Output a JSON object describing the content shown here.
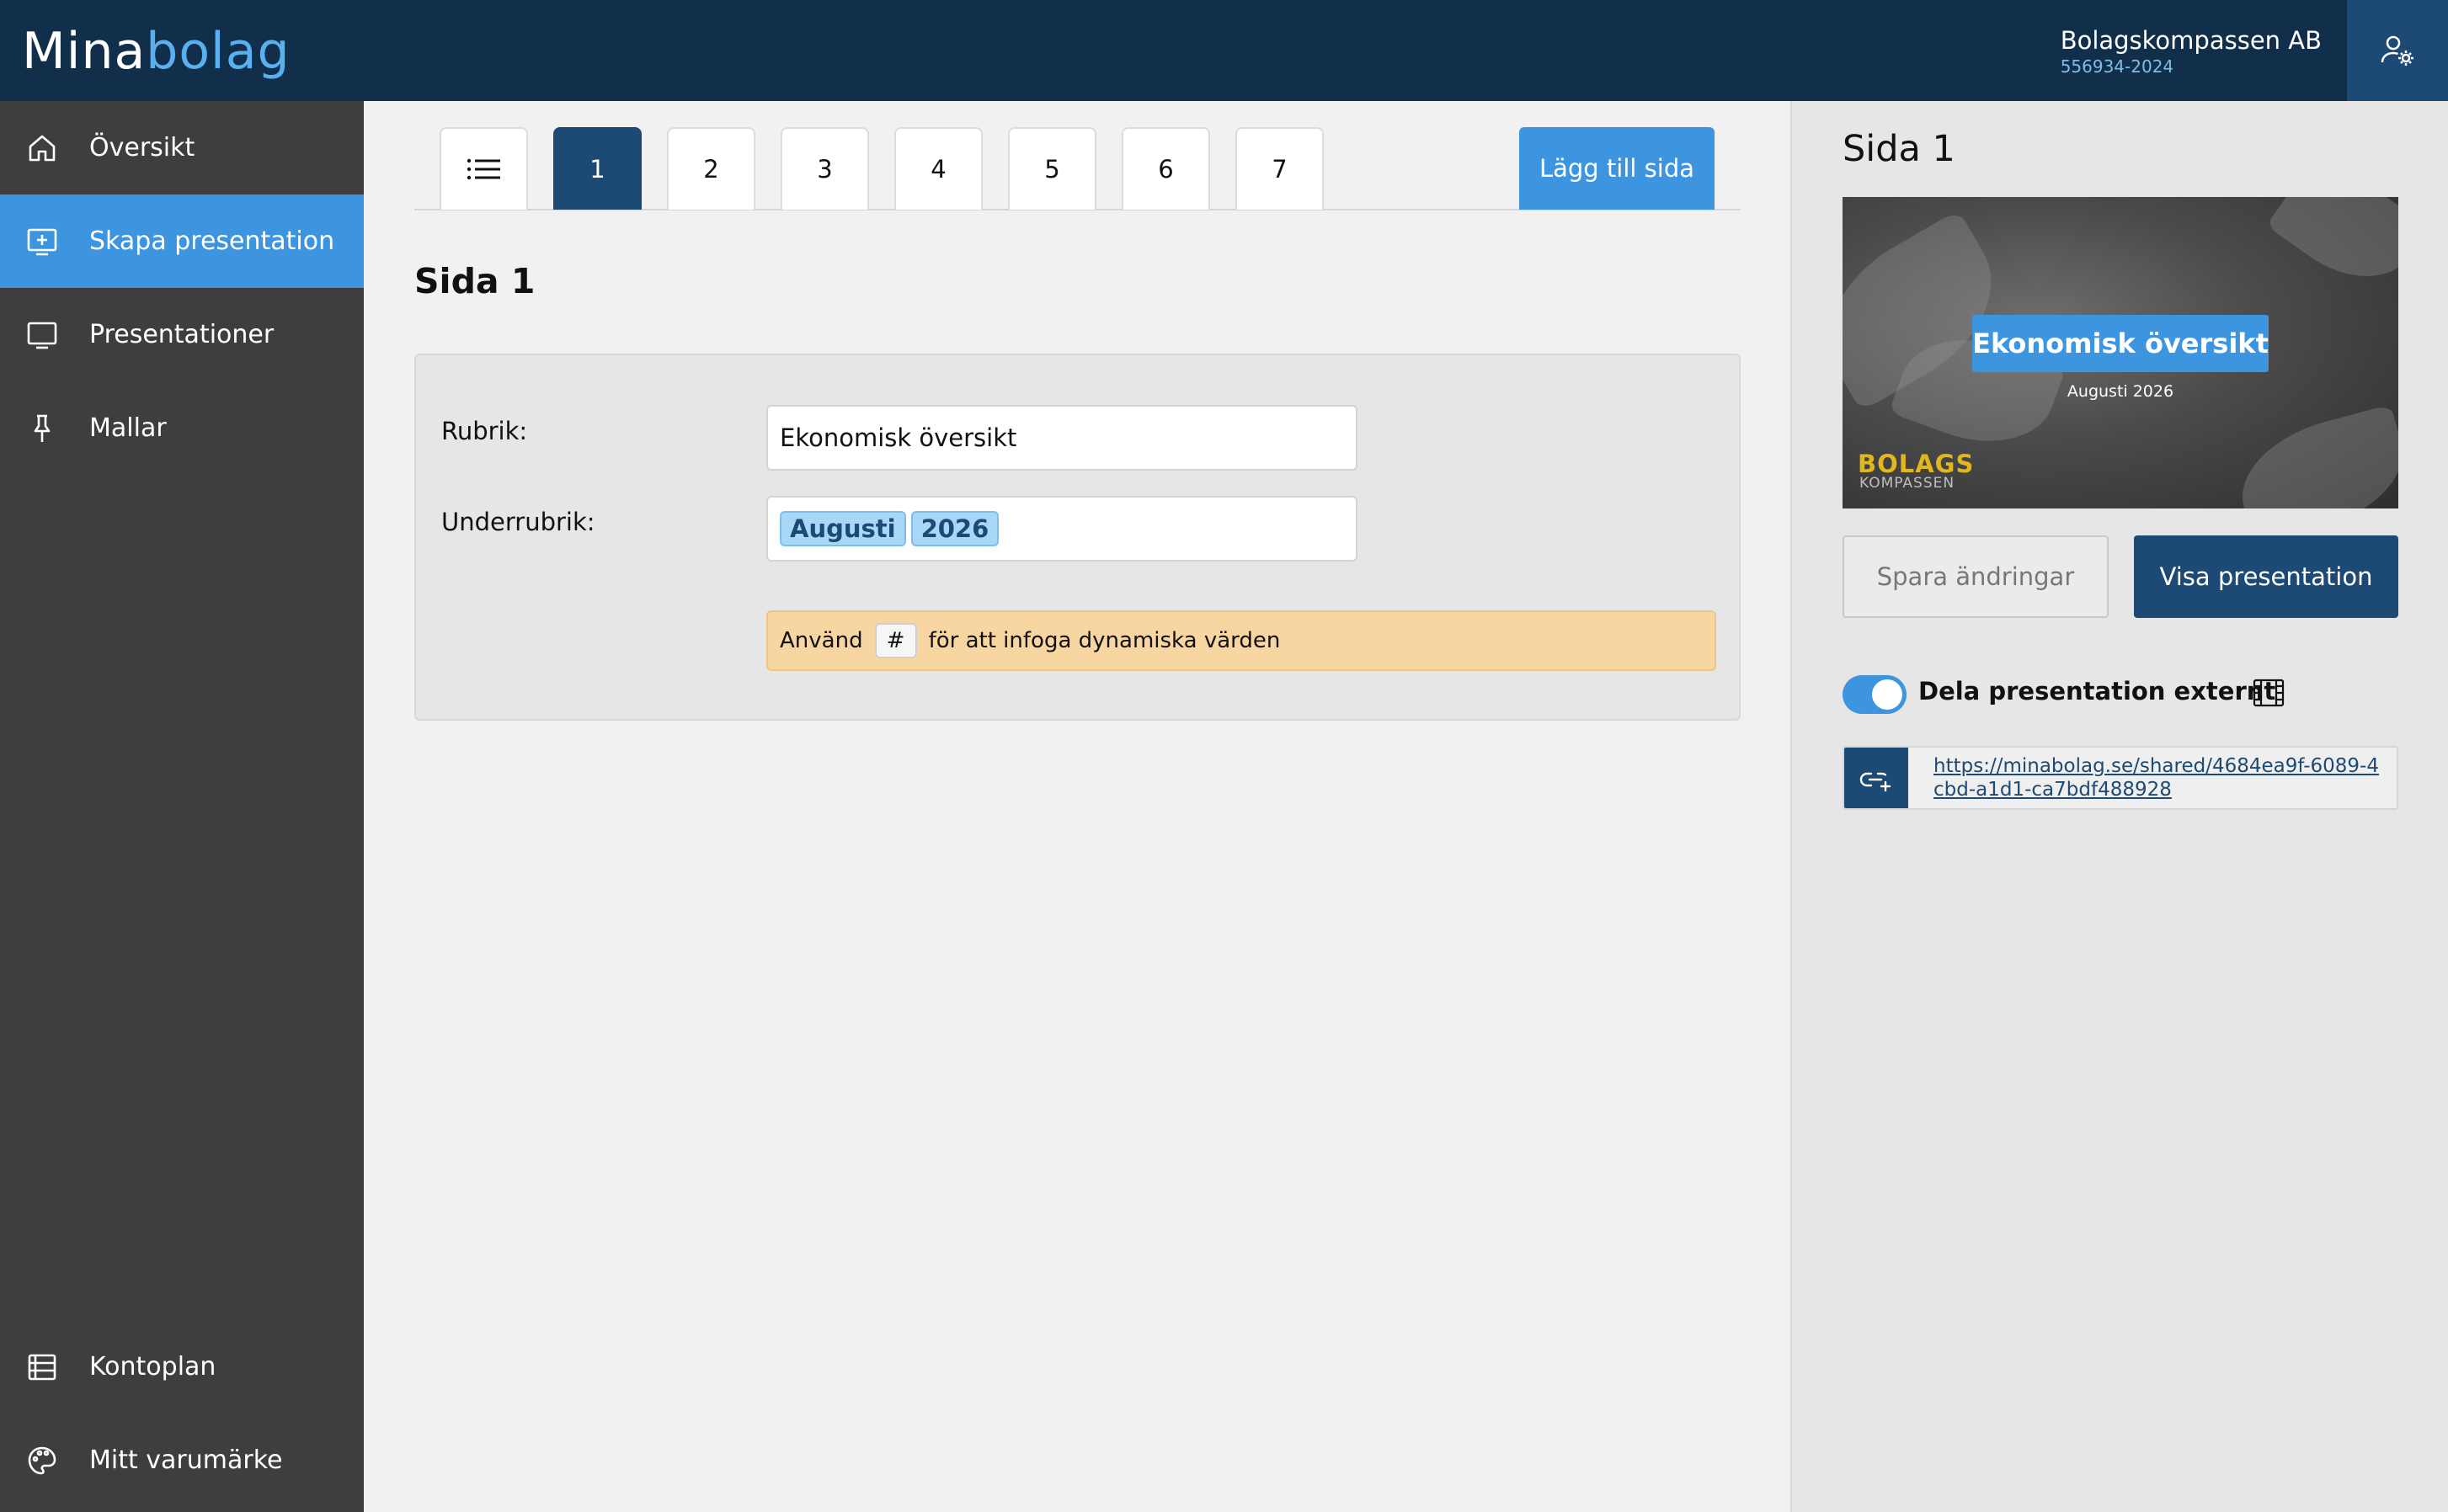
{
  "brand": {
    "part1": "Mina",
    "part2": "bolag"
  },
  "company": {
    "name": "Bolagskompassen AB",
    "org_number": "556934-2024"
  },
  "sidebar": {
    "items": [
      {
        "label": "Översikt",
        "icon": "home-icon",
        "active": false
      },
      {
        "label": "Skapa presentation",
        "icon": "add-presentation-icon",
        "active": true
      },
      {
        "label": "Presentationer",
        "icon": "monitor-icon",
        "active": false
      },
      {
        "label": "Mallar",
        "icon": "pin-icon",
        "active": false
      }
    ],
    "bottom_items": [
      {
        "label": "Kontoplan",
        "icon": "list-icon"
      },
      {
        "label": "Mitt varumärke",
        "icon": "palette-icon"
      }
    ]
  },
  "tabs": {
    "list_icon": "list-icon",
    "pages": [
      "1",
      "2",
      "3",
      "4",
      "5",
      "6",
      "7"
    ],
    "active_page": "1",
    "add_label": "Lägg till sida"
  },
  "editor": {
    "heading": "Sida 1",
    "rubrik_label": "Rubrik:",
    "rubrik_value": "Ekonomisk översikt",
    "underrubrik_label": "Underrubrik:",
    "underrubrik_chips": [
      "Augusti",
      "2026"
    ],
    "hint_prefix": "Använd",
    "hint_key": "#",
    "hint_suffix": "för att infoga dynamiska värden"
  },
  "preview_panel": {
    "title": "Sida 1",
    "slide_title": "Ekonomisk översikt",
    "slide_subtitle": "Augusti 2026",
    "slide_brand_top": "BOLAGS",
    "slide_brand_bottom": "KOMPASSEN",
    "save_label": "Spara ändringar",
    "show_label": "Visa presentation",
    "share_label": "Dela presentation externt",
    "share_enabled": true,
    "share_url": "https://minabolag.se/shared/4684ea9f-6089-4cbd-a1d1-ca7bdf488928"
  },
  "colors": {
    "topbar": "#112e4b",
    "accent": "#3d95e0",
    "dark_accent": "#1d4a75",
    "sidebar": "#3e3e3e",
    "hint_bg": "#f8d6a2"
  }
}
